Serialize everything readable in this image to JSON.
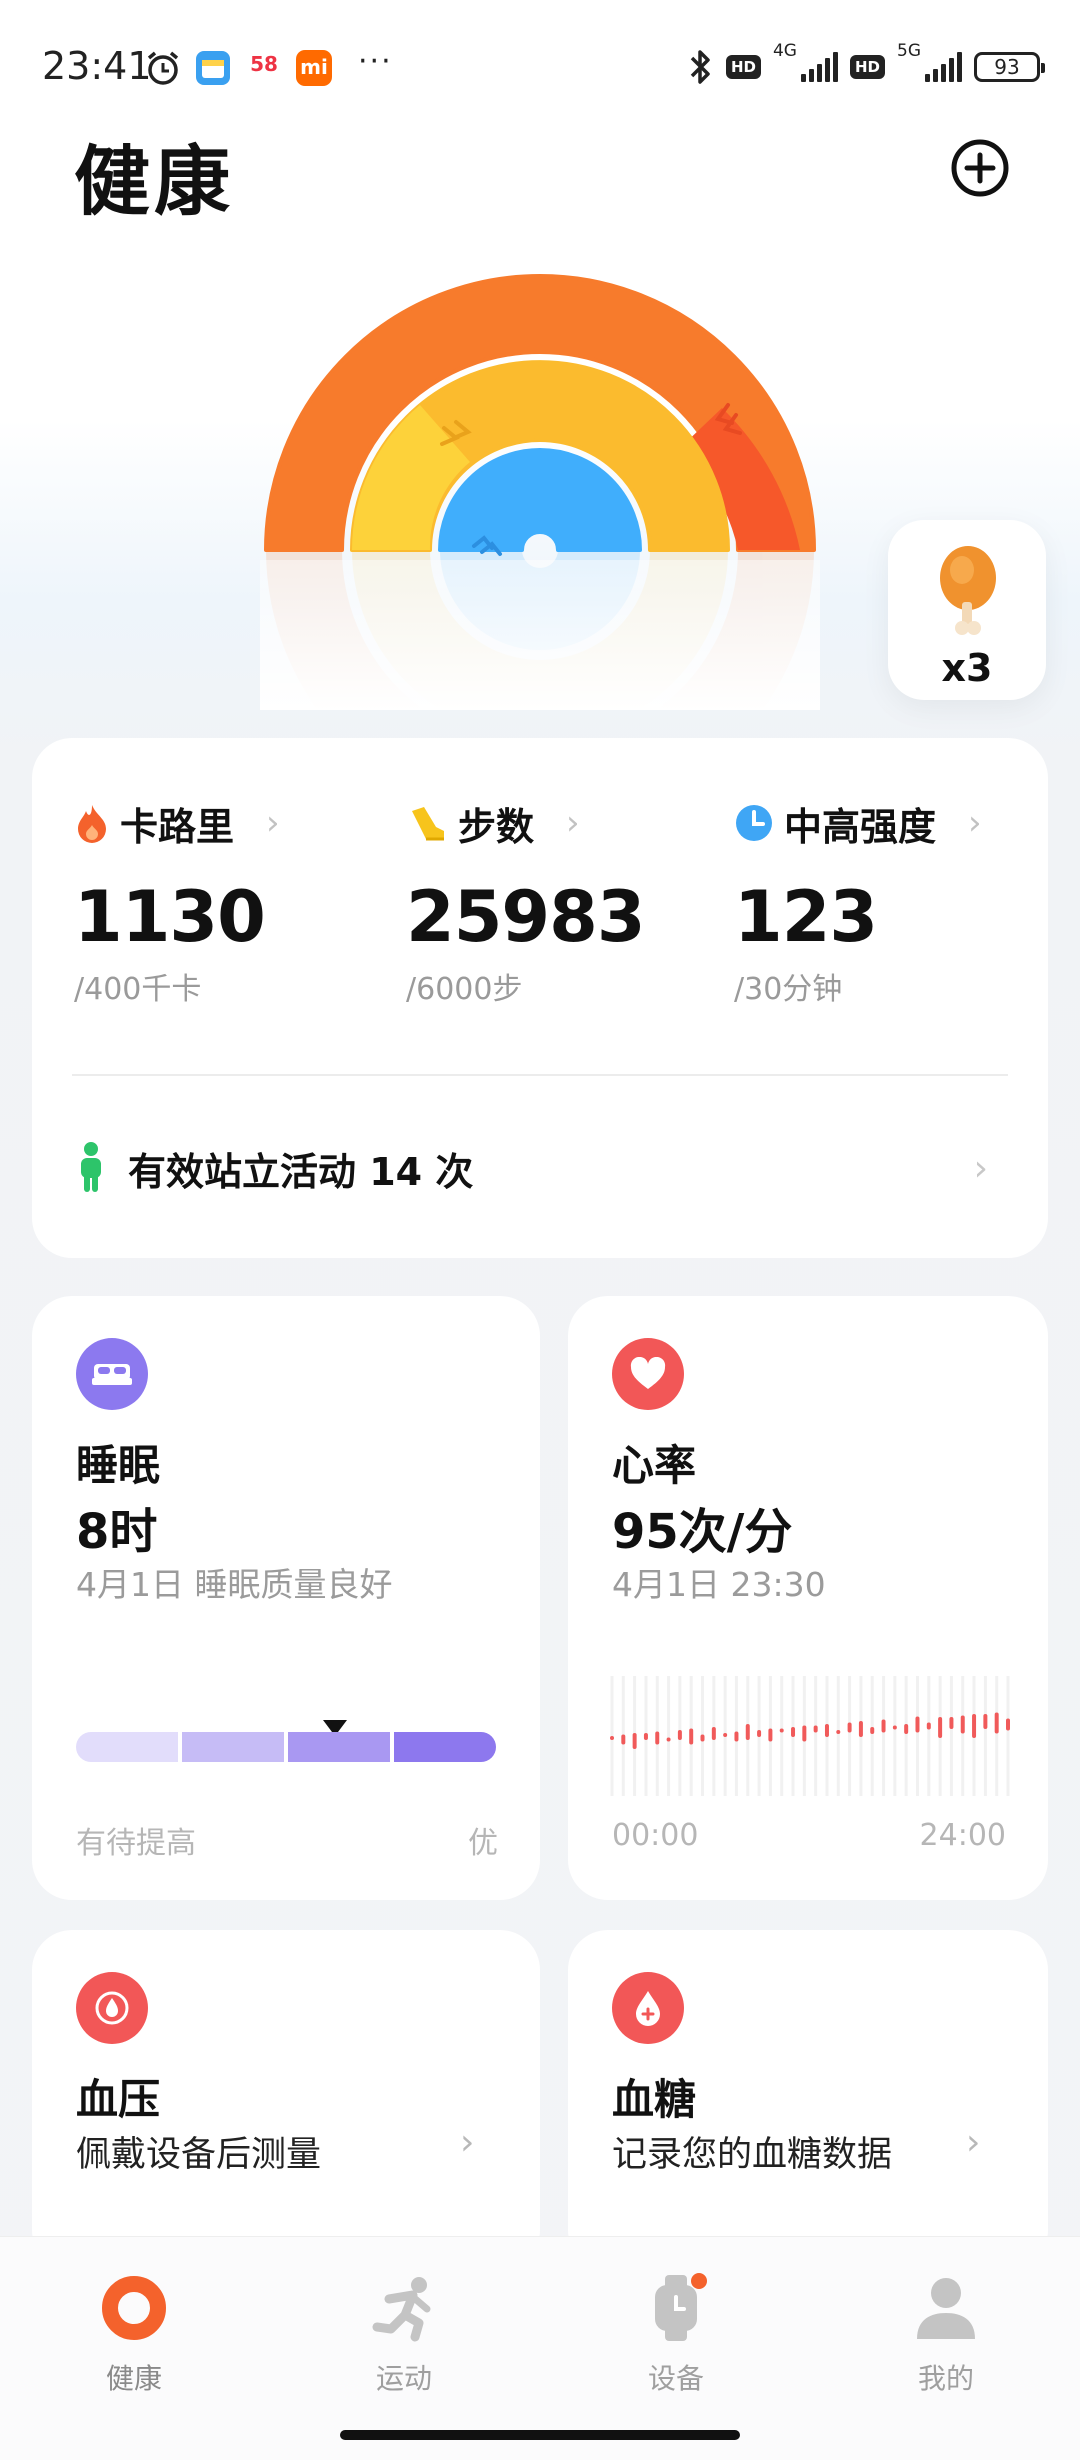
{
  "status_bar": {
    "time": "23:41",
    "icons": [
      "alarm-icon",
      "app-calendar-icon",
      "app-58-icon",
      "app-mi-icon",
      "more-dots-icon"
    ],
    "mi_label": "mi",
    "app58_label": "58",
    "more": "···",
    "hd": "HD",
    "net1": "4G",
    "net2": "5G",
    "battery": "93"
  },
  "header": {
    "title": "健康",
    "add_icon": "plus-circle-icon"
  },
  "rings": {
    "colors": {
      "outer": "#f77b2c",
      "middle": "#fbbb2e",
      "inner": "#40aefc"
    },
    "food_count": "x3"
  },
  "stats": {
    "items": [
      {
        "icon": "flame-icon",
        "title": "卡路里",
        "value": "1130",
        "goal": "/400千卡",
        "color": "#f4622c"
      },
      {
        "icon": "shoe-icon",
        "title": "步数",
        "value": "25983",
        "goal": "/6000步",
        "color": "#f7c41c"
      },
      {
        "icon": "clock-icon",
        "title": "中高强度",
        "value": "123",
        "goal": "/30分钟",
        "color": "#3fa6f5"
      }
    ],
    "stand_text": "有效站立活动 14 次",
    "chevron": "›"
  },
  "sleep": {
    "title": "睡眠",
    "value": "8时",
    "sub": "4月1日 睡眠质量良好",
    "axis_left": "有待提高",
    "axis_right": "优",
    "icon": "bed-icon",
    "level": 0.63
  },
  "heart": {
    "title": "心率",
    "value": "95次/分",
    "sub": "4月1日 23:30",
    "axis_left": "00:00",
    "axis_right": "24:00",
    "icon": "heart-icon"
  },
  "bp": {
    "title": "血压",
    "sub": "佩戴设备后测量",
    "icon": "blood-pressure-icon"
  },
  "glucose": {
    "title": "血糖",
    "sub": "记录您的血糖数据",
    "icon": "blood-drop-plus-icon"
  },
  "nav": [
    {
      "label": "健康",
      "icon": "health-ring-icon",
      "active": true
    },
    {
      "label": "运动",
      "icon": "runner-icon",
      "active": false
    },
    {
      "label": "设备",
      "icon": "watch-icon",
      "active": false
    },
    {
      "label": "我的",
      "icon": "person-icon",
      "active": false
    }
  ]
}
